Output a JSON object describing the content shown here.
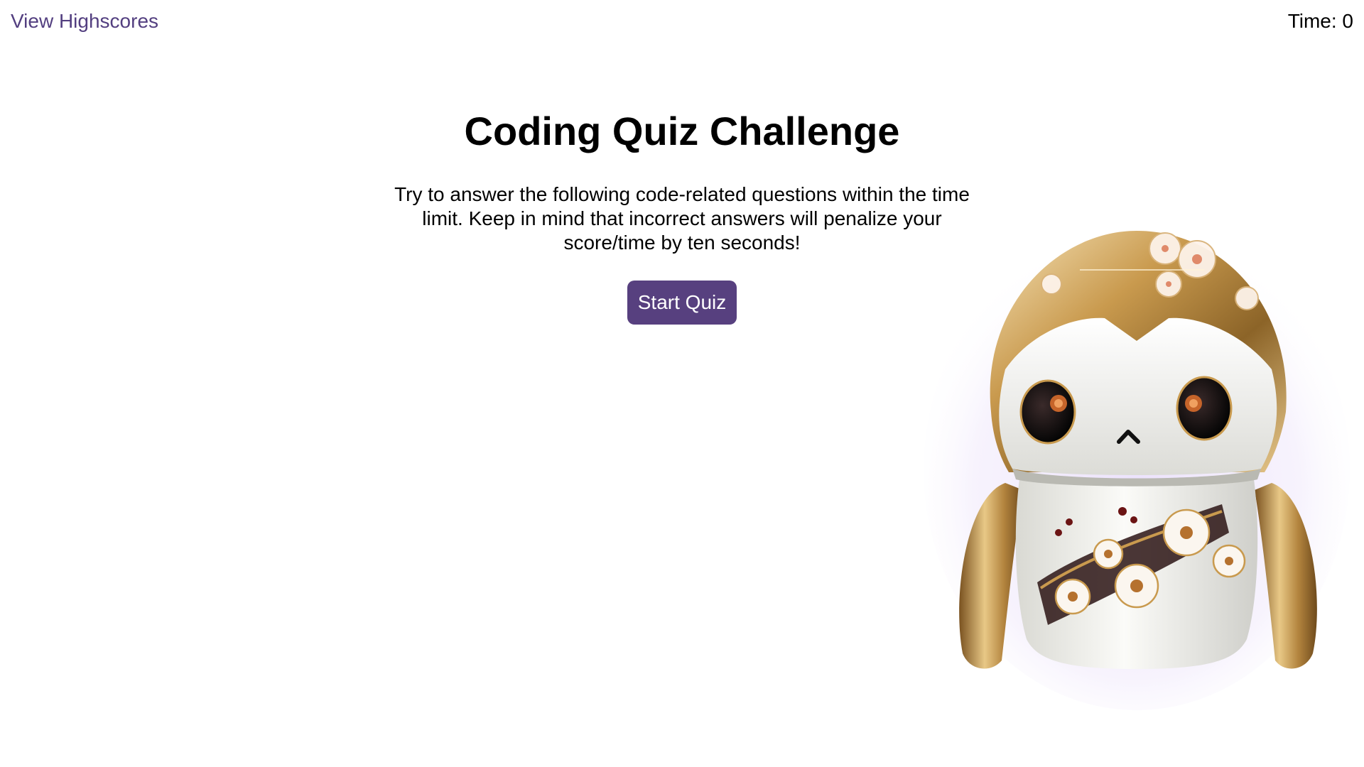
{
  "header": {
    "highscores_link": "View Highscores",
    "timer_label": "Time: 0"
  },
  "main": {
    "title": "Coding Quiz Challenge",
    "description": "Try to answer the following code-related questions within the time limit. Keep in mind that incorrect answers will penalize your score/time by ten seconds!",
    "start_button": "Start Quiz"
  },
  "image": {
    "icon": "robot-mascot-icon"
  },
  "colors": {
    "accent": "#57407f",
    "link": "#533f80",
    "gold": "#c9a25a"
  }
}
